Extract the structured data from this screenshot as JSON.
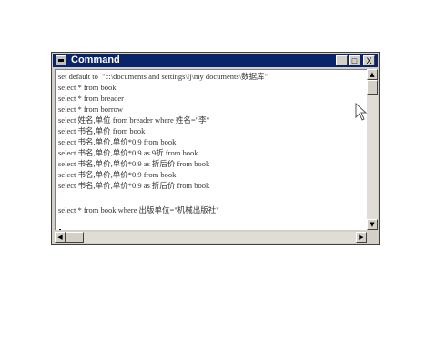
{
  "window": {
    "title": "Command"
  },
  "title_buttons": {
    "minimize": "_",
    "maximize": "□",
    "close": "X"
  },
  "lines": [
    "set default to  \"c:\\documents and settings\\lj\\my documents\\数据库\"",
    "select * from book",
    "select * from breader",
    "select * from borrow",
    "select 姓名,单位 from breader where 姓名=\"李\"",
    "select 书名,单价 from book",
    "select 书名,单价,单价*0.9 from book",
    "select 书名,单价,单价*0.9 as 9折 from book",
    "select 书名,单价,单价*0.9 as 折后价 from book",
    "select 书名,单价,单价*0.9 from book",
    "select 书名,单价,单价*0.9 as 折后价 from book",
    "",
    "select * from book where 出版单位=\"机械出版社\""
  ],
  "icons": {
    "window": "console-window-icon",
    "cursor": "mouse-pointer-icon",
    "scroll_up": "scroll-up-arrow-icon",
    "scroll_down": "scroll-down-arrow-icon",
    "scroll_left": "scroll-left-arrow-icon",
    "scroll_right": "scroll-right-arrow-icon"
  },
  "colors": {
    "titlebar": "#0a246a",
    "chrome": "#d4d0c8",
    "text": "#333333"
  }
}
